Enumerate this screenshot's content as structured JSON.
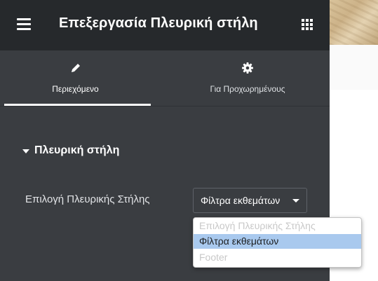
{
  "header": {
    "title": "Επεξεργασία Πλευρική στήλη",
    "menu_icon": "hamburger-menu-icon",
    "apps_icon": "grid-apps-icon"
  },
  "tabs": [
    {
      "label": "Περιεχόμενο",
      "icon": "pencil-icon",
      "active": true
    },
    {
      "label": "Για Προχωρημένους",
      "icon": "gear-icon",
      "active": false
    }
  ],
  "section": {
    "title": "Πλευρική στήλη",
    "expanded": true
  },
  "field": {
    "label": "Επιλογή Πλευρικής Στήλης",
    "value": "Φίλτρα εκθεμάτων",
    "options": [
      {
        "label": "Επιλογή Πλευρικής Στήλης",
        "state": "disabled"
      },
      {
        "label": "Φίλτρα εκθεμάτων",
        "state": "highlighted"
      },
      {
        "label": "Footer",
        "state": "disabled"
      }
    ]
  },
  "colors": {
    "panel_bg": "#3a3d41",
    "header_bg": "#26292c",
    "highlight": "#a9c9ee",
    "text": "#ffffff"
  }
}
